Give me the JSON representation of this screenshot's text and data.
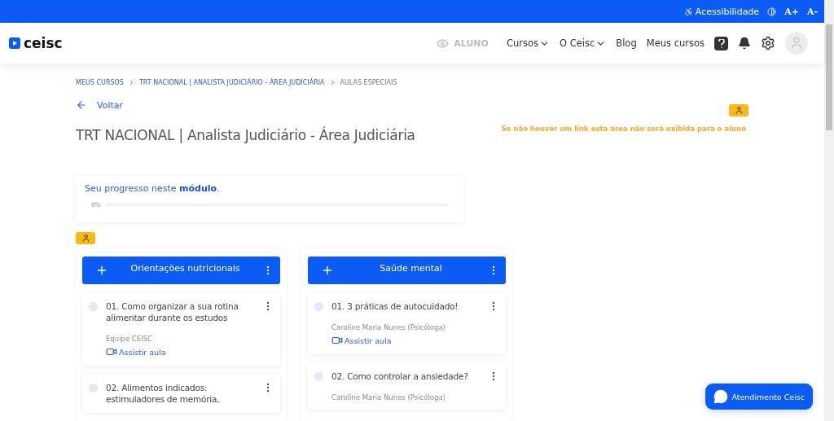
{
  "top_bar": {
    "accessibility": "Acessibilidade",
    "font_increase": "A+",
    "font_decrease": "A-"
  },
  "header": {
    "logo": "ceisc",
    "role": "ALUNO",
    "nav": [
      {
        "label": "Cursos",
        "kind": "dropdown"
      },
      {
        "label": "O Ceisc",
        "kind": "dropdown"
      },
      {
        "label": "Blog",
        "kind": "link"
      },
      {
        "label": "Meus cursos",
        "kind": "link"
      }
    ]
  },
  "breadcrumb": [
    {
      "label": "MEUS CURSOS",
      "selected": false
    },
    {
      "label": "TRT NACIONAL | ANALISTA JUDICIÁRIO - ÁREA JUDICIÁRIA",
      "selected": false
    },
    {
      "label": "AULAS ESPECIAIS",
      "selected": true
    }
  ],
  "back": "Voltar",
  "title": "TRT NACIONAL | Analista Judiciário - Área Judiciária",
  "notice": "Se não houver um link esta área não será exibida para o aluno",
  "progress": {
    "label": "Seu progresso neste **módulo**.",
    "reading": "0%",
    "level": 0
  },
  "modules": [
    {
      "title": "Orientações nutricionais",
      "lessons": [
        {
          "title": "01. Como organizar a sua rotina alimentar durante os estudos",
          "author": "Equipe CEISC",
          "link": "Assistir aula",
          "checked": false
        },
        {
          "title": "02. Alimentos indicados: estimuladores de memória,",
          "checked": false
        }
      ]
    },
    {
      "title": "Saúde mental",
      "lessons": [
        {
          "title": "01. 3 práticas de autocuidado!",
          "author": "Caroline Maria Nunes (Psicóloga)",
          "link": "Assistir aula",
          "checked": false
        },
        {
          "title": "02. Como controlar a ansiedade?",
          "author": "Caroline Maria Nunes (Psicóloga)",
          "checked": false
        }
      ]
    }
  ],
  "chat_button": "Atendimento Ceisc"
}
